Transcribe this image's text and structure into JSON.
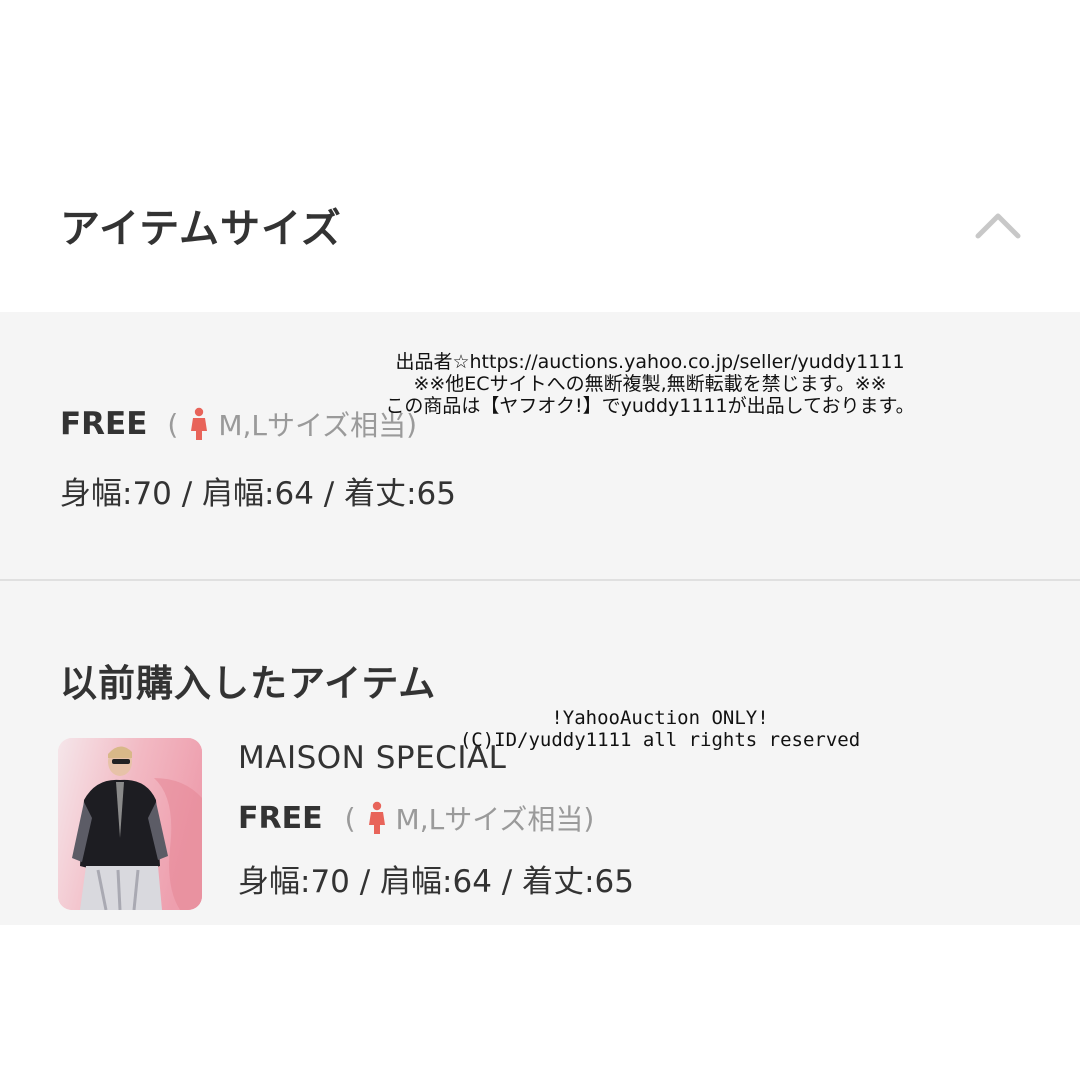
{
  "item_size": {
    "title": "アイテムサイズ",
    "toggle_icon": "chevron-up-icon",
    "size_label": "FREE",
    "paren_open": "(",
    "paren_close": ")",
    "size_note": "M,Lサイズ相当",
    "measurements": "身幅:70 / 肩幅:64 / 着丈:65"
  },
  "watermark_top": {
    "line1": "出品者☆https://auctions.yahoo.co.jp/seller/yuddy1111",
    "line2": "※※他ECサイトへの無断複製,無断転載を禁じます。※※",
    "line3": "この商品は【ヤフオク!】でyuddy1111が出品しております。"
  },
  "previous_items": {
    "title": "以前購入したアイテム",
    "items": [
      {
        "brand": "MAISON SPECIAL",
        "size_label": "FREE",
        "paren_open": "(",
        "paren_close": ")",
        "size_note": "M,Lサイズ相当",
        "measurements": "身幅:70 / 肩幅:64 / 着丈:65",
        "thumbnail": "product-photo"
      }
    ]
  },
  "watermark_bottom": {
    "line1": "!YahooAuction ONLY!",
    "line2": "(C)ID/yuddy1111 all rights reserved"
  },
  "colors": {
    "accent_icon": "#e8645a",
    "muted_text": "#9a9a9a",
    "panel_bg": "#f5f5f5"
  }
}
